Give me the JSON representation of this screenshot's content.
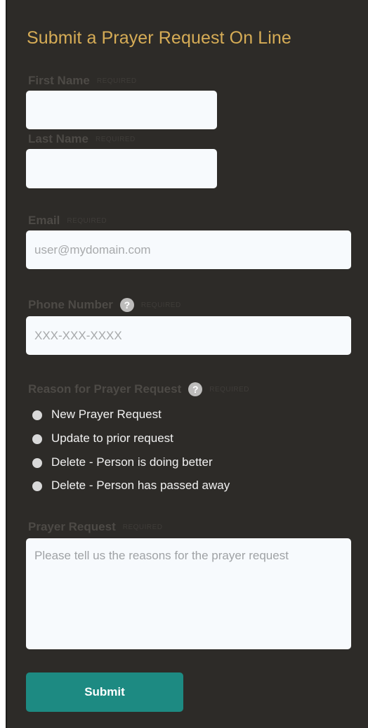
{
  "form": {
    "title": "Submit a Prayer Request On Line",
    "required_text": "REQUIRED",
    "first_name": {
      "label": "First Name",
      "value": ""
    },
    "last_name": {
      "label": "Last Name",
      "value": ""
    },
    "email": {
      "label": "Email",
      "placeholder": "user@mydomain.com"
    },
    "phone": {
      "label": "Phone Number",
      "placeholder": "XXX-XXX-XXXX",
      "help_icon": "?"
    },
    "reason": {
      "label": "Reason for Prayer Request",
      "help_icon": "?",
      "options": [
        "New Prayer Request",
        "Update to prior request",
        "Delete - Person is doing better",
        "Delete - Person has passed away"
      ]
    },
    "prayer_request": {
      "label": "Prayer Request",
      "placeholder": "Please tell us the reasons for the prayer request"
    },
    "submit_label": "Submit"
  },
  "colors": {
    "background": "#2d2b28",
    "title": "#d6ac56",
    "label": "#4d4a46",
    "input_bg": "#f7fafd",
    "button": "#1d8a82"
  }
}
